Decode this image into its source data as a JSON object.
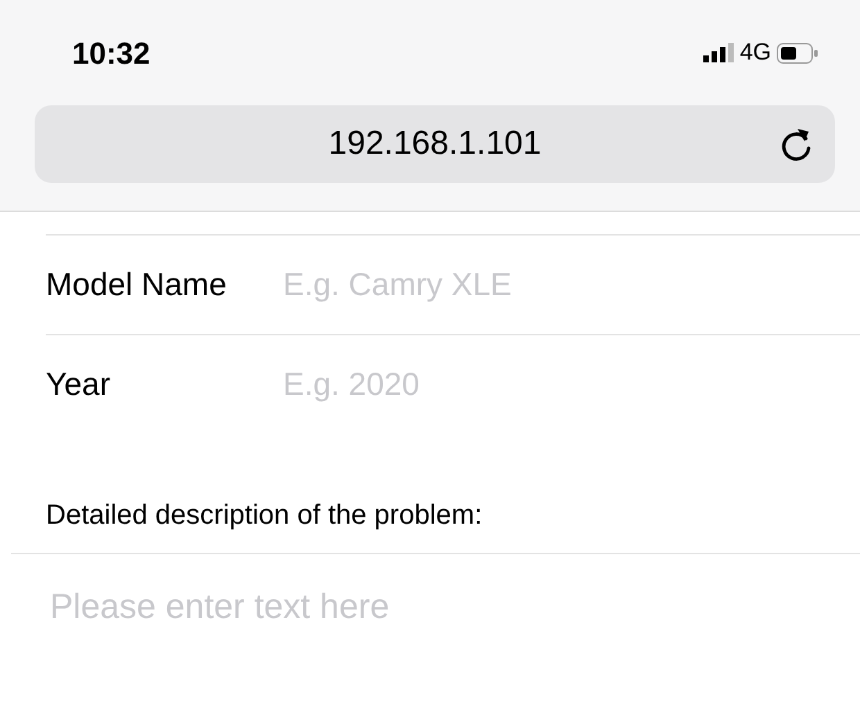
{
  "status_bar": {
    "time": "10:32",
    "network": "4G"
  },
  "address_bar": {
    "url": "192.168.1.101"
  },
  "form": {
    "fields": [
      {
        "label": "Model Name",
        "placeholder": "E.g. Camry XLE"
      },
      {
        "label": "Year",
        "placeholder": "E.g. 2020"
      }
    ],
    "description": {
      "label": "Detailed description of the problem:",
      "placeholder": "Please enter text here"
    }
  }
}
